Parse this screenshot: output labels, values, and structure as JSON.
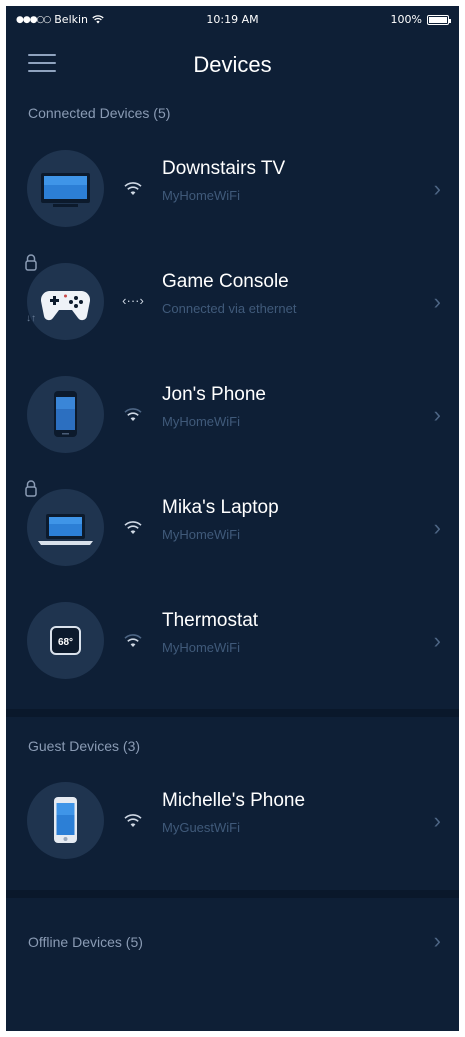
{
  "status_bar": {
    "carrier": "Belkin",
    "time": "10:19 AM",
    "battery": "100%"
  },
  "nav": {
    "title": "Devices"
  },
  "connected": {
    "header": "Connected Devices (5)",
    "devices": [
      {
        "name": "Downstairs TV",
        "network": "MyHomeWiFi",
        "icon": "tv-icon",
        "connection": "wifi"
      },
      {
        "name": "Game Console",
        "network": "Connected via ethernet",
        "icon": "gamepad-icon",
        "connection": "ethernet",
        "ethernet_glyph": "‹···›",
        "transfer_glyph": "↓↑"
      },
      {
        "name": "Jon's Phone",
        "network": "MyHomeWiFi",
        "icon": "phone-icon",
        "connection": "wifi"
      },
      {
        "name": "Mika's Laptop",
        "network": "MyHomeWiFi",
        "icon": "laptop-icon",
        "connection": "wifi"
      },
      {
        "name": "Thermostat",
        "network": "MyHomeWiFi",
        "icon": "thermostat-icon",
        "connection": "wifi",
        "display": "68°"
      }
    ]
  },
  "guest": {
    "header": "Guest Devices (3)",
    "devices": [
      {
        "name": "Michelle's Phone",
        "network": "MyGuestWiFi",
        "icon": "phone-icon",
        "connection": "wifi"
      }
    ]
  },
  "offline": {
    "label": "Offline Devices (5)"
  },
  "chevron": "›",
  "colors": {
    "background": "#0e1f36",
    "avatar": "#1f344f",
    "subtext": "#405a7a",
    "header_text": "#8a9bb4"
  }
}
